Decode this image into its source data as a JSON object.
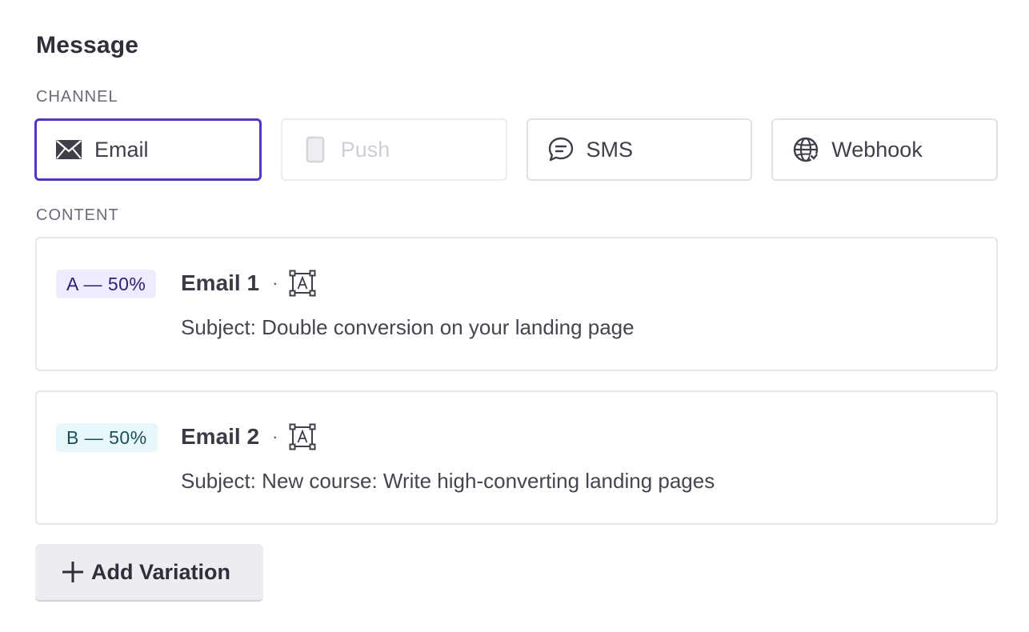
{
  "message": {
    "title": "Message"
  },
  "channel": {
    "label": "CHANNEL",
    "options": [
      {
        "label": "Email",
        "icon": "envelope-icon",
        "state": "selected"
      },
      {
        "label": "Push",
        "icon": "mobile-phone-icon",
        "state": "disabled"
      },
      {
        "label": "SMS",
        "icon": "chat-bubble-icon",
        "state": "default"
      },
      {
        "label": "Webhook",
        "icon": "globe-icon",
        "state": "default"
      }
    ]
  },
  "content": {
    "label": "CONTENT",
    "variations": [
      {
        "badge": "A — 50%",
        "title": "Email 1",
        "separator": "·",
        "icon": "template-icon",
        "subject": "Subject: Double conversion on your landing page"
      },
      {
        "badge": "B — 50%",
        "title": "Email 2",
        "separator": "·",
        "icon": "template-icon",
        "subject": "Subject: New course: Write high-converting landing pages"
      }
    ]
  },
  "actions": {
    "add_variation_label": "Add Variation"
  },
  "colors": {
    "accent": "#5433c7",
    "badge_a_bg": "#efeafd",
    "badge_b_bg": "#e8f8fa"
  }
}
